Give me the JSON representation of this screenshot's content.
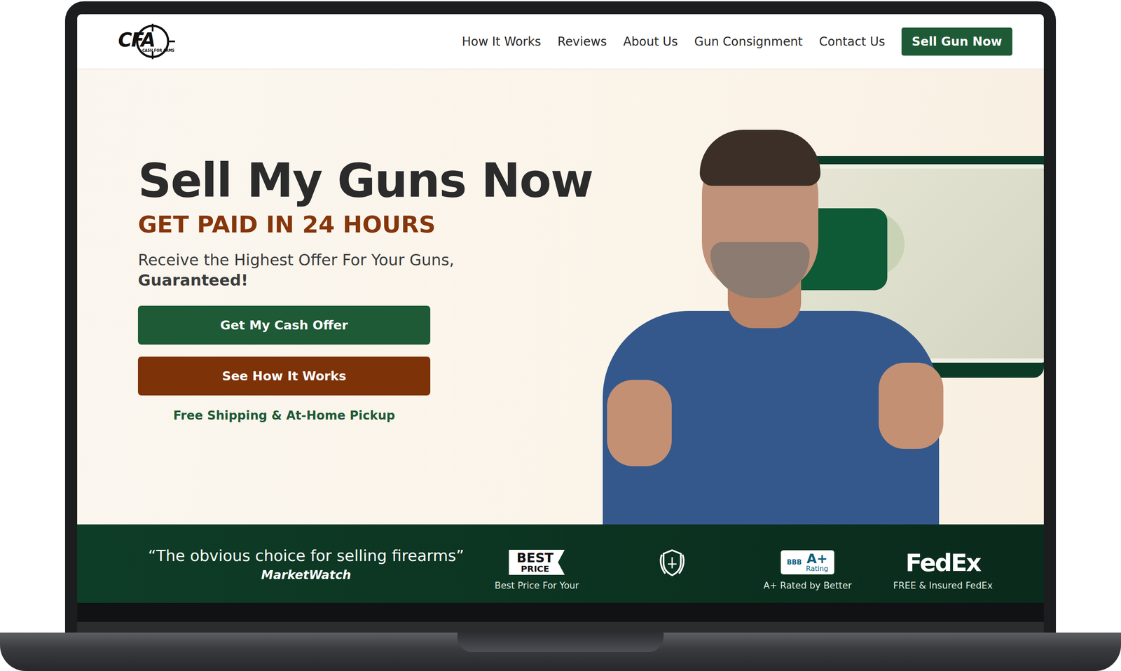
{
  "logo": {
    "mark": "CFA",
    "tagline": "CASH FOR ARMS"
  },
  "nav": {
    "links": [
      "How It Works",
      "Reviews",
      "About Us",
      "Gun Consignment",
      "Contact Us"
    ],
    "cta": "Sell Gun Now"
  },
  "hero": {
    "title": "Sell My Guns Now",
    "subtitle": "GET PAID IN 24 HOURS",
    "text": "Receive the Highest Offer For Your Guns,",
    "text_strong": "Guaranteed!",
    "buttons": [
      {
        "label": "Get My Cash Offer",
        "kind": "primary"
      },
      {
        "label": "See How It Works",
        "kind": "secondary"
      }
    ],
    "note": "Free Shipping & At-Home Pickup"
  },
  "trust": {
    "quote": "“The obvious choice for selling firearms”",
    "source": "MarketWatch",
    "badges": [
      {
        "kind": "best-price",
        "labels": [
          "BEST",
          "PRICE"
        ],
        "caption": "Best Price For Your"
      },
      {
        "kind": "shield",
        "labels": [],
        "caption": ""
      },
      {
        "kind": "bbb",
        "labels": [
          "BBB",
          "A+",
          "Rating"
        ],
        "caption": "A+ Rated by Better"
      },
      {
        "kind": "fedex",
        "labels": [
          "FedEx"
        ],
        "caption": "FREE & Insured FedEx"
      }
    ]
  }
}
